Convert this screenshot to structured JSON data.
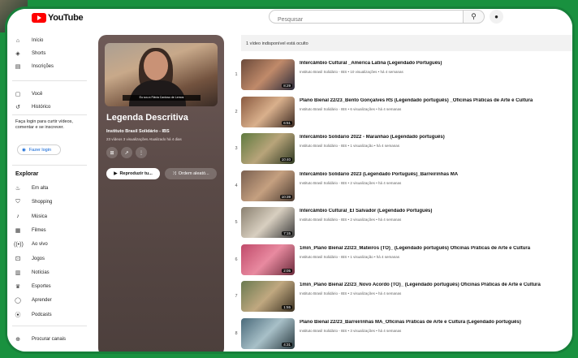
{
  "app": {
    "logo_text": "YouTube"
  },
  "search": {
    "placeholder": "Pesquisar"
  },
  "sidebar": {
    "items": [
      {
        "label": "Início",
        "icon": "home-icon",
        "glyph": "⌂"
      },
      {
        "label": "Shorts",
        "icon": "shorts-icon",
        "glyph": "◈"
      },
      {
        "label": "Inscrições",
        "icon": "subscriptions-icon",
        "glyph": "▤"
      },
      {
        "label": "Você",
        "icon": "you-icon",
        "glyph": "▢"
      },
      {
        "label": "Histórico",
        "icon": "history-icon",
        "glyph": "↺"
      }
    ],
    "login_prompt": "Faça login para curtir vídeos, comentar e se inscrever.",
    "login_button": "Fazer login",
    "explore_title": "Explorar",
    "explore_items": [
      {
        "label": "Em alta",
        "icon": "trending-icon",
        "glyph": "♨"
      },
      {
        "label": "Shopping",
        "icon": "shopping-icon",
        "glyph": "⛉"
      },
      {
        "label": "Música",
        "icon": "music-icon",
        "glyph": "♪"
      },
      {
        "label": "Filmes",
        "icon": "movies-icon",
        "glyph": "▦"
      },
      {
        "label": "Ao vivo",
        "icon": "live-icon",
        "glyph": "((•))"
      },
      {
        "label": "Jogos",
        "icon": "gaming-icon",
        "glyph": "⚀"
      },
      {
        "label": "Notícias",
        "icon": "news-icon",
        "glyph": "▥"
      },
      {
        "label": "Esportes",
        "icon": "sports-icon",
        "glyph": "♛"
      },
      {
        "label": "Aprender",
        "icon": "learning-icon",
        "glyph": "◯"
      },
      {
        "label": "Podcasts",
        "icon": "podcasts-icon",
        "glyph": "⦿"
      }
    ],
    "browse_channels": {
      "label": "Procurar canais",
      "icon": "add-circle-icon",
      "glyph": "⊕"
    }
  },
  "playlist": {
    "title": "Legenda Descritiva",
    "channel": "Instituto Brasil Solidário - IBS",
    "meta": "23 vídeos  3 visualizações  Atualizado há 4 dias",
    "thumb_caption": "Eu sou a Flávia Cardoso de Lemos",
    "play_all": "Reproduzir tu...",
    "shuffle": "Ordem aleató..."
  },
  "notice": "1 vídeo indisponível está oculto",
  "videos": [
    {
      "index": "1",
      "title": "Intercâmbio Cultural _América Latina (Legendado Português)",
      "meta": "Instituto Brasil Solidário - IBS • 10 visualizações • há 4 semanas",
      "duration": "8:29",
      "colors": [
        "#6b4a3a",
        "#c08a6a",
        "#2a2a3a"
      ]
    },
    {
      "index": "2",
      "title": "Plano Bienal 22/23_Bento Gonçalves RS (Legendado português) _Oficinas Práticas de Arte e Cultura",
      "meta": "Instituto Brasil Solidário - IBS • 6 visualizações • há 4 semanas",
      "duration": "6:51",
      "colors": [
        "#8a5a40",
        "#d9b08c",
        "#3c2a22"
      ]
    },
    {
      "index": "3",
      "title": "Intercâmbio Solidário 2022 - Maranhão (Legendado português)",
      "meta": "Instituto Brasil Solidário - IBS • 1 visualização • há 4 semanas",
      "duration": "10:40",
      "colors": [
        "#5f7a3f",
        "#b8a47a",
        "#2f3a22"
      ]
    },
    {
      "index": "4",
      "title": "Intercâmbio Solidário 2023 (Legendado Português)_Barreirinhas MA",
      "meta": "Instituto Brasil Solidário - IBS • 2 visualizações • há 4 semanas",
      "duration": "10:39",
      "colors": [
        "#7a6050",
        "#c5a080",
        "#4a3a30"
      ]
    },
    {
      "index": "5",
      "title": "Intercâmbio Cultural_El Salvador (Legendado Português)",
      "meta": "Instituto Brasil Solidário - IBS • 2 visualizações • há 4 semanas",
      "duration": "7:15",
      "colors": [
        "#8a8070",
        "#d8cfc0",
        "#3a3a3a"
      ]
    },
    {
      "index": "6",
      "title": "1min_Plano Bienal 22/23_Mateiros (TO)_ (Legendado português) Oficinas Práticas de Arte e Cultura",
      "meta": "Instituto Brasil Solidário - IBS • 1 visualização • há 4 semanas",
      "duration": "2:05",
      "colors": [
        "#c04a6a",
        "#e88aa0",
        "#6a2a3a"
      ]
    },
    {
      "index": "7",
      "title": "1min_Plano Bienal 22/23_Novo Acordo (TO)_ (Legendado português) Oficinas Práticas de Arte e Cultura",
      "meta": "Instituto Brasil Solidário - IBS • 2 visualizações • há 4 semanas",
      "duration": "1:55",
      "colors": [
        "#6a7a50",
        "#c0a880",
        "#3a3020"
      ]
    },
    {
      "index": "8",
      "title": "Plano Bienal 22/23_Barreirinhas MA_Oficinas Práticas de Arte e Cultura (Legendado português)",
      "meta": "Instituto Brasil Solidário - IBS • 3 visualizações • há 4 semanas",
      "duration": "4:31",
      "colors": [
        "#4a6a7a",
        "#a8c0c8",
        "#2a3a40"
      ]
    }
  ]
}
